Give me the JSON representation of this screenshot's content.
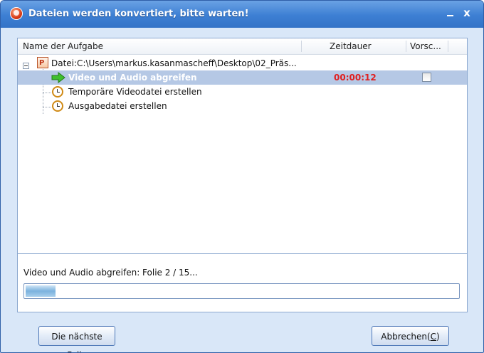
{
  "window": {
    "title": "Dateien werden konvertiert, bitte warten!",
    "minimize_glyph": "_",
    "close_glyph": "x"
  },
  "table": {
    "columns": [
      "Name der Aufgabe",
      "Zeitdauer",
      "Vorsc..."
    ],
    "file_row": {
      "label": "Datei:C:\\Users\\markus.kasanmascheff\\Desktop\\02_Präs...",
      "icon": "powerpoint-file-icon"
    },
    "tasks": [
      {
        "label": "Video und Audio abgreifen",
        "duration": "00:00:12",
        "icon": "green-arrow-icon",
        "selected": true,
        "checked": false
      },
      {
        "label": "Temporäre Videodatei erstellen",
        "duration": "",
        "icon": "alarm-clock-icon",
        "selected": false
      },
      {
        "label": "Ausgabedatei erstellen",
        "duration": "",
        "icon": "alarm-clock-icon",
        "selected": false
      }
    ]
  },
  "status": {
    "text": "Video und Audio abgreifen: Folie 2 / 15...",
    "progress": 0.07
  },
  "buttons": {
    "next_slide": "Die nächste Folie",
    "cancel_prefix": "Abbrechen(",
    "cancel_accel": "C",
    "cancel_suffix": ")"
  },
  "colors": {
    "title_bar": "#3d7fd3",
    "selection": "#b5c8e5",
    "duration_active": "#e01f1f"
  }
}
